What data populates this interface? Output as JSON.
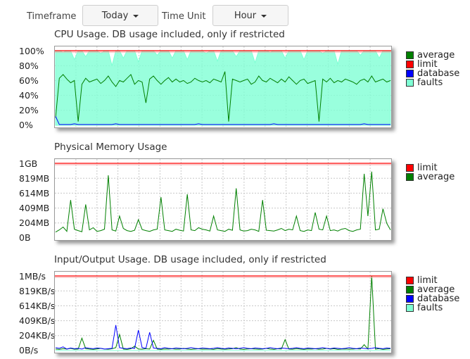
{
  "toolbar": {
    "timeframe_label": "Timeframe",
    "timeframe_value": "Today",
    "timeunit_label": "Time Unit",
    "timeunit_value": "Hour"
  },
  "colors": {
    "average": "#008000",
    "limit": "#ff0000",
    "database": "#0000ff",
    "faults": "#7fffd4"
  },
  "chart_data": [
    {
      "id": "cpu",
      "type": "line",
      "title": "CPU Usage. DB usage included, only if restricted",
      "yticks": [
        "100%",
        "80%",
        "60%",
        "40%",
        "20%",
        "0%"
      ],
      "ylim": [
        0,
        100
      ],
      "limit": 100,
      "grid": true,
      "legend": [
        {
          "key": "average",
          "label": "average"
        },
        {
          "key": "limit",
          "label": "limit"
        },
        {
          "key": "database",
          "label": "database"
        },
        {
          "key": "faults",
          "label": "faults"
        }
      ],
      "series": [
        {
          "key": "average",
          "values": [
            10,
            63,
            68,
            62,
            57,
            60,
            5,
            55,
            63,
            58,
            60,
            62,
            56,
            60,
            66,
            58,
            52,
            60,
            58,
            63,
            68,
            55,
            60,
            58,
            30,
            62,
            66,
            60,
            55,
            60,
            64,
            58,
            62,
            58,
            60,
            56,
            58,
            63,
            60,
            58,
            60,
            57,
            62,
            60,
            58,
            72,
            5,
            62,
            60,
            58,
            60,
            62,
            55,
            58,
            66,
            60,
            58,
            63,
            60,
            57,
            62,
            58,
            65,
            60,
            55,
            60,
            62,
            56,
            58,
            60,
            5,
            62,
            58,
            63,
            57,
            60,
            58,
            62,
            60,
            58,
            55,
            60,
            62,
            58,
            66,
            58,
            60,
            62,
            58,
            60
          ]
        },
        {
          "key": "database",
          "values": [
            12,
            1,
            1,
            1,
            1,
            2,
            1,
            1,
            1,
            1,
            1,
            1,
            1,
            1,
            1,
            1,
            2,
            1,
            1,
            1,
            1,
            1,
            1,
            1,
            1,
            1,
            1,
            1,
            1,
            1,
            1,
            1,
            1,
            1,
            1,
            1,
            1,
            1,
            2,
            1,
            1,
            1,
            1,
            1,
            1,
            1,
            1,
            1,
            1,
            1,
            1,
            1,
            1,
            1,
            1,
            1,
            1,
            1,
            2,
            1,
            1,
            1,
            1,
            1,
            1,
            1,
            1,
            1,
            1,
            1,
            1,
            1,
            1,
            1,
            1,
            1,
            1,
            1,
            1,
            1,
            1,
            1,
            2,
            1,
            1,
            1,
            1,
            1,
            1,
            1
          ]
        },
        {
          "key": "faults",
          "values": [
            100,
            100,
            98,
            100,
            100,
            88,
            100,
            100,
            92,
            100,
            100,
            100,
            96,
            100,
            100,
            80,
            100,
            100,
            90,
            100,
            100,
            100,
            85,
            100,
            100,
            100,
            100,
            94,
            100,
            100,
            100,
            90,
            100,
            100,
            100,
            88,
            100,
            100,
            100,
            100,
            96,
            100,
            100,
            86,
            100,
            100,
            100,
            100,
            92,
            100,
            100,
            100,
            100,
            84,
            100,
            100,
            100,
            98,
            100,
            100,
            100,
            90,
            100,
            100,
            100,
            100,
            88,
            100,
            100,
            100,
            100,
            96,
            100,
            100,
            100,
            82,
            100,
            100,
            100,
            100,
            100,
            94,
            100,
            100,
            100,
            100,
            90,
            100,
            100,
            100
          ]
        }
      ]
    },
    {
      "id": "memory",
      "type": "line",
      "title": "Physical Memory Usage",
      "yticks": [
        "1GB",
        "819MB",
        "614MB",
        "409MB",
        "204MB",
        "0B"
      ],
      "ylim": [
        0,
        1024
      ],
      "limit": 1024,
      "grid": true,
      "legend": [
        {
          "key": "limit",
          "label": "limit"
        },
        {
          "key": "average",
          "label": "average"
        }
      ],
      "series": [
        {
          "key": "average",
          "values": [
            80,
            110,
            150,
            90,
            520,
            120,
            100,
            85,
            460,
            110,
            140,
            90,
            100,
            120,
            860,
            110,
            95,
            300,
            130,
            100,
            90,
            105,
            250,
            115,
            100,
            90,
            110,
            120,
            560,
            110,
            100,
            90,
            120,
            105,
            95,
            600,
            110,
            100,
            140,
            120,
            110,
            95,
            300,
            110,
            100,
            90,
            120,
            105,
            680,
            110,
            95,
            100,
            120,
            110,
            90,
            520,
            105,
            100,
            95,
            110,
            130,
            100,
            120,
            110,
            300,
            100,
            90,
            110,
            100,
            350,
            120,
            110,
            300,
            100,
            110,
            95,
            120,
            130,
            100,
            90,
            110,
            120,
            880,
            300,
            910,
            110,
            120,
            400,
            200,
            110
          ]
        }
      ]
    },
    {
      "id": "io",
      "type": "line",
      "title": "Input/Output Usage. DB usage included, only if restricted",
      "yticks": [
        "1MB/s",
        "819KB/s",
        "614KB/s",
        "409KB/s",
        "204KB/s",
        "0B/s"
      ],
      "ylim": [
        0,
        1024
      ],
      "limit": 1024,
      "grid": true,
      "legend": [
        {
          "key": "limit",
          "label": "limit"
        },
        {
          "key": "average",
          "label": "average"
        },
        {
          "key": "database",
          "label": "database"
        },
        {
          "key": "faults",
          "label": "faults"
        }
      ],
      "series": [
        {
          "key": "average",
          "values": [
            20,
            15,
            25,
            20,
            30,
            18,
            20,
            170,
            25,
            20,
            15,
            22,
            30,
            20,
            18,
            25,
            40,
            220,
            20,
            15,
            25,
            60,
            20,
            18,
            25,
            20,
            140,
            20,
            15,
            22,
            20,
            25,
            18,
            20,
            30,
            20,
            15,
            20,
            25,
            18,
            20,
            22,
            15,
            25,
            20,
            18,
            20,
            25,
            40,
            20,
            15,
            22,
            25,
            20,
            18,
            20,
            30,
            20,
            15,
            25,
            20,
            150,
            20,
            18,
            25,
            20,
            15,
            22,
            20,
            25,
            18,
            20,
            30,
            20,
            25,
            15,
            20,
            22,
            18,
            20,
            25,
            20,
            80,
            20,
            1024,
            20,
            25,
            15,
            20,
            25
          ]
        },
        {
          "key": "database",
          "values": [
            40,
            30,
            50,
            20,
            35,
            25,
            30,
            20,
            40,
            30,
            25,
            35,
            30,
            20,
            25,
            30,
            350,
            40,
            30,
            25,
            35,
            30,
            280,
            40,
            30,
            250,
            35,
            30,
            25,
            40,
            30,
            25,
            35,
            30,
            25,
            30,
            40,
            30,
            25,
            35,
            30,
            25,
            30,
            40,
            30,
            25,
            35,
            30,
            25,
            30,
            40,
            30,
            25,
            35,
            30,
            25,
            30,
            40,
            30,
            25,
            35,
            30,
            25,
            30,
            40,
            30,
            25,
            35,
            30,
            25,
            30,
            40,
            30,
            25,
            35,
            30,
            25,
            30,
            40,
            30,
            25,
            35,
            30,
            25,
            30,
            40,
            30,
            25,
            35,
            30
          ]
        },
        {
          "key": "faults",
          "values": [
            0,
            0,
            0,
            0,
            0,
            0,
            0,
            0,
            0,
            0,
            0,
            0,
            0,
            0,
            0,
            0,
            0,
            0,
            0,
            0,
            0,
            0,
            0,
            0,
            0,
            0,
            0,
            0,
            0,
            0,
            0,
            0,
            0,
            0,
            0,
            0,
            0,
            0,
            0,
            0,
            0,
            0,
            0,
            0,
            0,
            0,
            0,
            0,
            0,
            0,
            0,
            0,
            0,
            0,
            0,
            0,
            0,
            0,
            0,
            0,
            0,
            0,
            0,
            0,
            0,
            0,
            0,
            0,
            0,
            0,
            0,
            0,
            0,
            0,
            0,
            0,
            0,
            0,
            0,
            0,
            0,
            0,
            0,
            0,
            0,
            0,
            0,
            0,
            0,
            0
          ]
        }
      ]
    }
  ]
}
